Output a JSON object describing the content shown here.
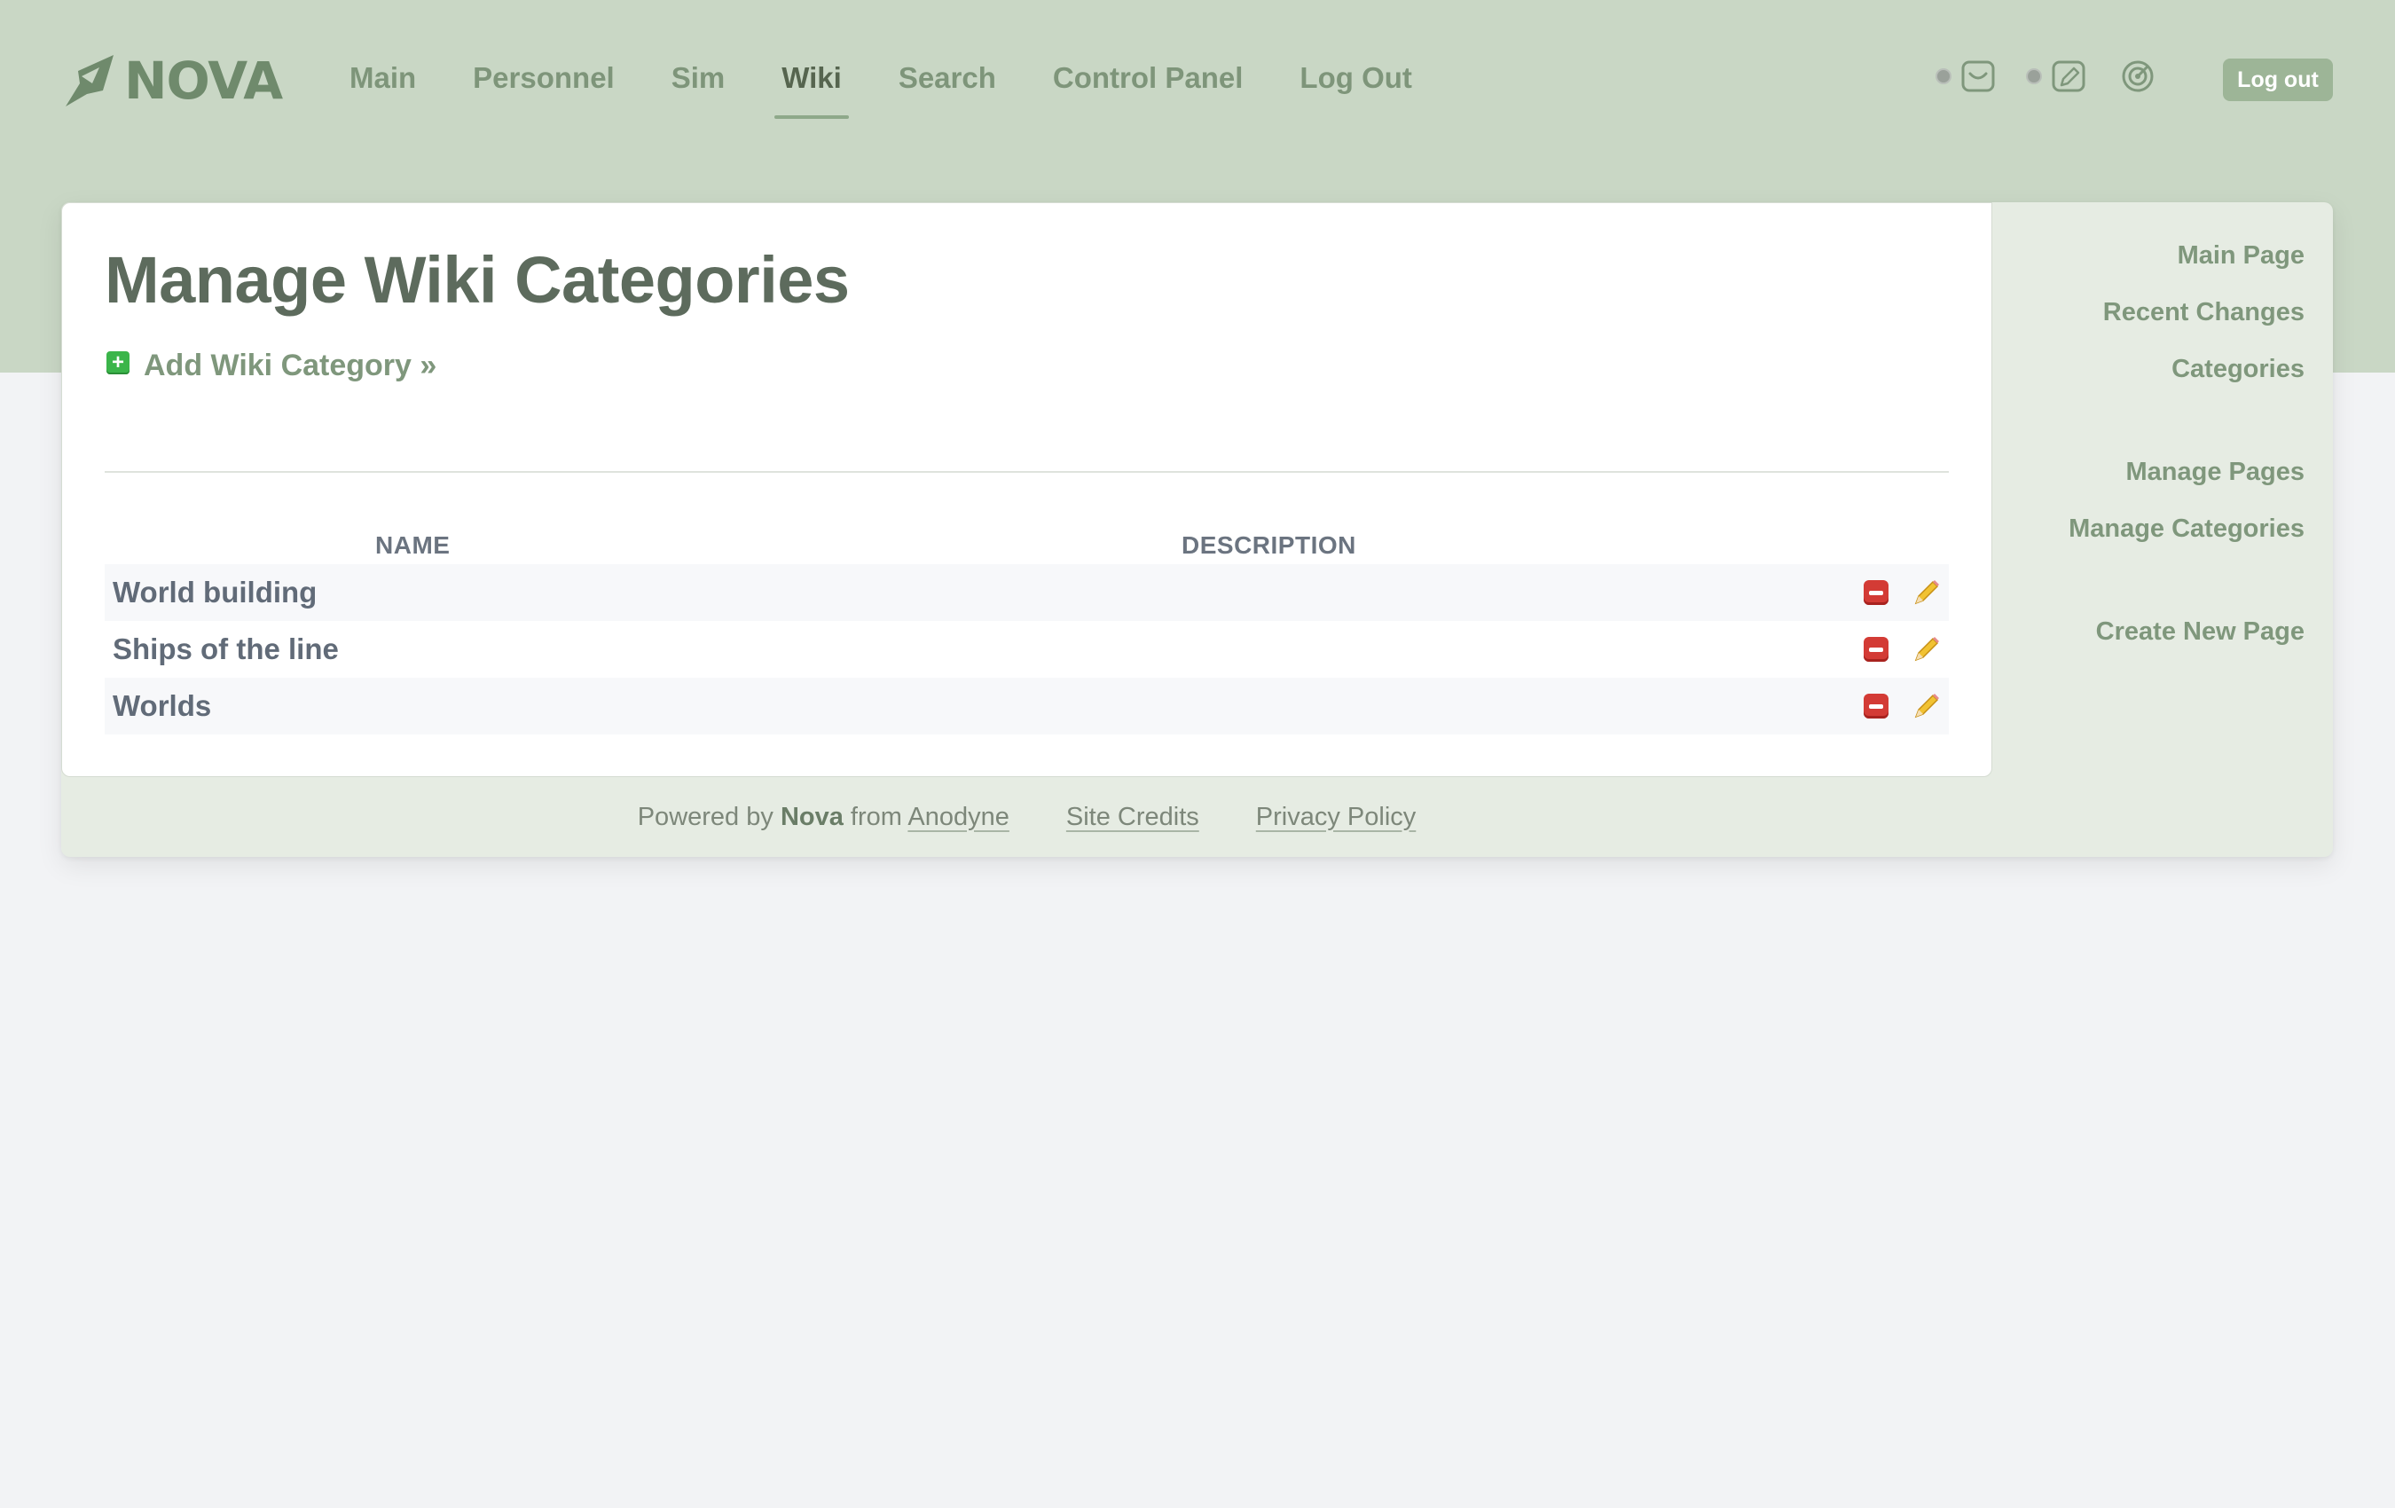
{
  "brand": {
    "name": "NOVA"
  },
  "nav": {
    "items": [
      {
        "label": "Main",
        "active": false
      },
      {
        "label": "Personnel",
        "active": false
      },
      {
        "label": "Sim",
        "active": false
      },
      {
        "label": "Wiki",
        "active": true
      },
      {
        "label": "Search",
        "active": false
      },
      {
        "label": "Control Panel",
        "active": false
      },
      {
        "label": "Log Out",
        "active": false
      }
    ],
    "logout_button": "Log out"
  },
  "page": {
    "title": "Manage Wiki Categories",
    "add_link": "Add Wiki Category »"
  },
  "table": {
    "headers": {
      "name": "NAME",
      "description": "DESCRIPTION"
    },
    "rows": [
      {
        "name": "World building",
        "description": ""
      },
      {
        "name": "Ships of the line",
        "description": ""
      },
      {
        "name": "Worlds",
        "description": ""
      }
    ]
  },
  "sidebar": {
    "links": [
      "Main Page",
      "Recent Changes",
      "Categories",
      "Manage Pages",
      "Manage Categories",
      "Create New Page"
    ]
  },
  "footer": {
    "powered_prefix": "Powered by",
    "powered_brand": "Nova",
    "powered_from": "from",
    "anodyne": "Anodyne",
    "site_credits": "Site Credits",
    "privacy_policy": "Privacy Policy"
  },
  "colors": {
    "header_bg": "#c9d7c5",
    "accent": "#7f977c",
    "logout_bg": "#9db597",
    "delete_red": "#d33b35",
    "add_green": "#3bb54a"
  },
  "icons": [
    "nova-logo-icon",
    "inbox-icon",
    "write-icon",
    "radar-icon",
    "add-icon",
    "delete-icon",
    "edit-pencil-icon"
  ]
}
